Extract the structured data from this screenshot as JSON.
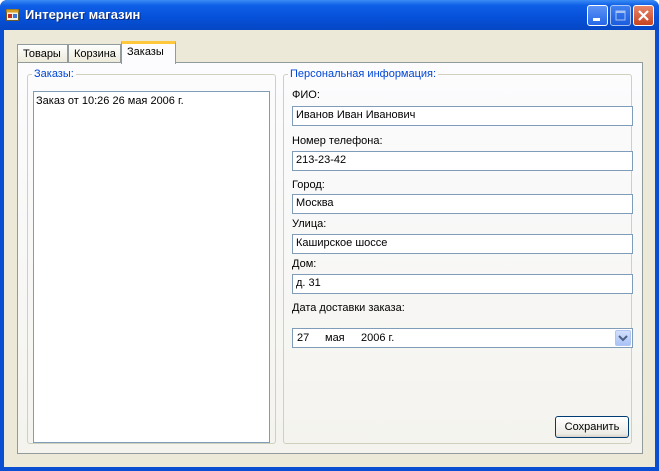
{
  "window": {
    "title": "Интернет магазин",
    "icon": "app-window-icon",
    "controls": [
      "minimize-icon",
      "maximize-icon",
      "close-icon"
    ]
  },
  "tabs": [
    {
      "label": "Товары",
      "selected": false
    },
    {
      "label": "Корзина",
      "selected": false
    },
    {
      "label": "Заказы",
      "selected": true
    }
  ],
  "orders": {
    "group_title": "Заказы:",
    "items": [
      "Заказ от 10:26 26 мая 2006 г."
    ]
  },
  "personal": {
    "group_title": "Персональная информация:",
    "name_label": "ФИО:",
    "name_value": "Иванов Иван Иванович",
    "phone_label": "Номер телефона:",
    "phone_value": "213-23-42",
    "city_label": "Город:",
    "city_value": "Москва",
    "street_label": "Улица:",
    "street_value": "Каширское шоссе",
    "house_label": "Дом:",
    "house_value": "д. 31",
    "delivery_label": "Дата доставки заказа:",
    "delivery_day": "27",
    "delivery_month": "мая",
    "delivery_year": "2006 г."
  },
  "save_label": "Сохранить",
  "colors": {
    "titlebar": "#0650d8",
    "group_title": "#0046d5",
    "selected_tab_accent": "#ffc83c",
    "client_background": "#ece9d8"
  }
}
